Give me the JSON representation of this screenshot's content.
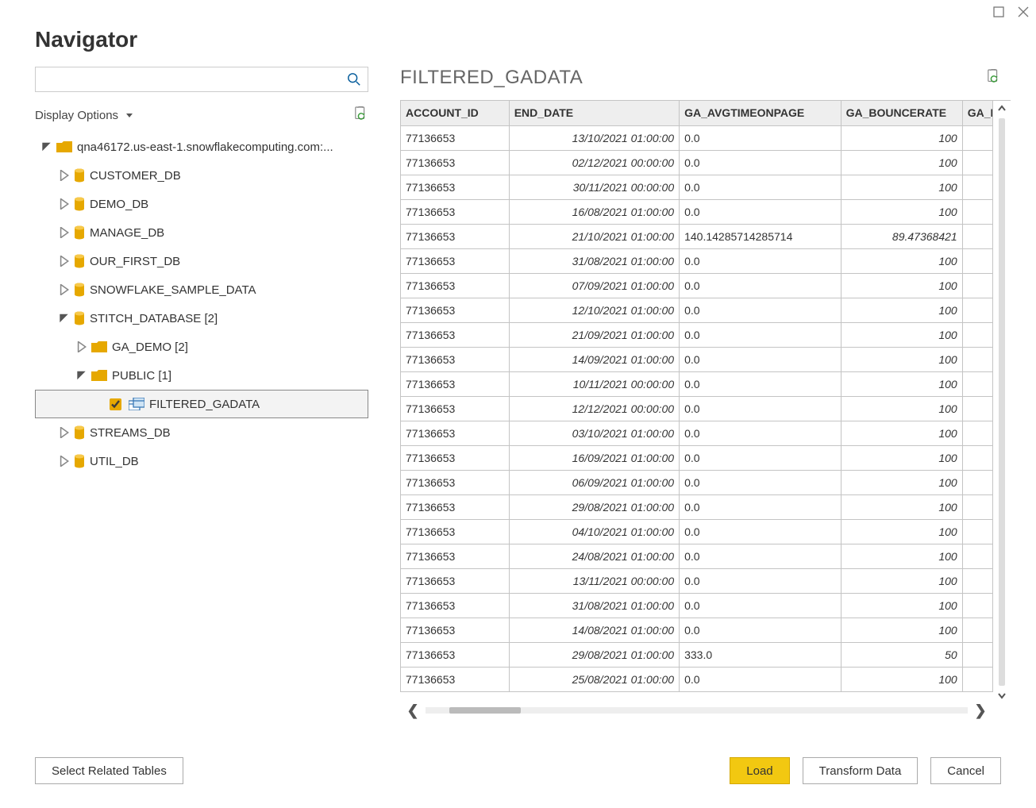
{
  "dialog": {
    "title": "Navigator"
  },
  "search": {
    "placeholder": ""
  },
  "display_options": {
    "label": "Display Options"
  },
  "tree": {
    "root": {
      "label": "qna46172.us-east-1.snowflakecomputing.com:..."
    },
    "items": [
      {
        "label": "CUSTOMER_DB"
      },
      {
        "label": "DEMO_DB"
      },
      {
        "label": "MANAGE_DB"
      },
      {
        "label": "OUR_FIRST_DB"
      },
      {
        "label": "SNOWFLAKE_SAMPLE_DATA"
      },
      {
        "label": "STITCH_DATABASE [2]"
      },
      {
        "label": "STREAMS_DB"
      },
      {
        "label": "UTIL_DB"
      }
    ],
    "stitch_children": [
      {
        "label": "GA_DEMO [2]"
      },
      {
        "label": "PUBLIC [1]"
      }
    ],
    "public_children": [
      {
        "label": "FILTERED_GADATA"
      }
    ]
  },
  "preview": {
    "title": "FILTERED_GADATA",
    "columns": {
      "c0": "ACCOUNT_ID",
      "c1": "END_DATE",
      "c2": "GA_AVGTIMEONPAGE",
      "c3": "GA_BOUNCERATE",
      "c4": "GA_D"
    },
    "rows": [
      {
        "acct": "77136653",
        "end": "13/10/2021 01:00:00",
        "avg": "0.0",
        "bounce": "100"
      },
      {
        "acct": "77136653",
        "end": "02/12/2021 00:00:00",
        "avg": "0.0",
        "bounce": "100"
      },
      {
        "acct": "77136653",
        "end": "30/11/2021 00:00:00",
        "avg": "0.0",
        "bounce": "100"
      },
      {
        "acct": "77136653",
        "end": "16/08/2021 01:00:00",
        "avg": "0.0",
        "bounce": "100"
      },
      {
        "acct": "77136653",
        "end": "21/10/2021 01:00:00",
        "avg": "140.14285714285714",
        "bounce": "89.47368421"
      },
      {
        "acct": "77136653",
        "end": "31/08/2021 01:00:00",
        "avg": "0.0",
        "bounce": "100"
      },
      {
        "acct": "77136653",
        "end": "07/09/2021 01:00:00",
        "avg": "0.0",
        "bounce": "100"
      },
      {
        "acct": "77136653",
        "end": "12/10/2021 01:00:00",
        "avg": "0.0",
        "bounce": "100"
      },
      {
        "acct": "77136653",
        "end": "21/09/2021 01:00:00",
        "avg": "0.0",
        "bounce": "100"
      },
      {
        "acct": "77136653",
        "end": "14/09/2021 01:00:00",
        "avg": "0.0",
        "bounce": "100"
      },
      {
        "acct": "77136653",
        "end": "10/11/2021 00:00:00",
        "avg": "0.0",
        "bounce": "100"
      },
      {
        "acct": "77136653",
        "end": "12/12/2021 00:00:00",
        "avg": "0.0",
        "bounce": "100"
      },
      {
        "acct": "77136653",
        "end": "03/10/2021 01:00:00",
        "avg": "0.0",
        "bounce": "100"
      },
      {
        "acct": "77136653",
        "end": "16/09/2021 01:00:00",
        "avg": "0.0",
        "bounce": "100"
      },
      {
        "acct": "77136653",
        "end": "06/09/2021 01:00:00",
        "avg": "0.0",
        "bounce": "100"
      },
      {
        "acct": "77136653",
        "end": "29/08/2021 01:00:00",
        "avg": "0.0",
        "bounce": "100"
      },
      {
        "acct": "77136653",
        "end": "04/10/2021 01:00:00",
        "avg": "0.0",
        "bounce": "100"
      },
      {
        "acct": "77136653",
        "end": "24/08/2021 01:00:00",
        "avg": "0.0",
        "bounce": "100"
      },
      {
        "acct": "77136653",
        "end": "13/11/2021 00:00:00",
        "avg": "0.0",
        "bounce": "100"
      },
      {
        "acct": "77136653",
        "end": "31/08/2021 01:00:00",
        "avg": "0.0",
        "bounce": "100"
      },
      {
        "acct": "77136653",
        "end": "14/08/2021 01:00:00",
        "avg": "0.0",
        "bounce": "100"
      },
      {
        "acct": "77136653",
        "end": "29/08/2021 01:00:00",
        "avg": "333.0",
        "bounce": "50"
      },
      {
        "acct": "77136653",
        "end": "25/08/2021 01:00:00",
        "avg": "0.0",
        "bounce": "100"
      }
    ]
  },
  "footer": {
    "select_related": "Select Related Tables",
    "load": "Load",
    "transform": "Transform Data",
    "cancel": "Cancel"
  }
}
